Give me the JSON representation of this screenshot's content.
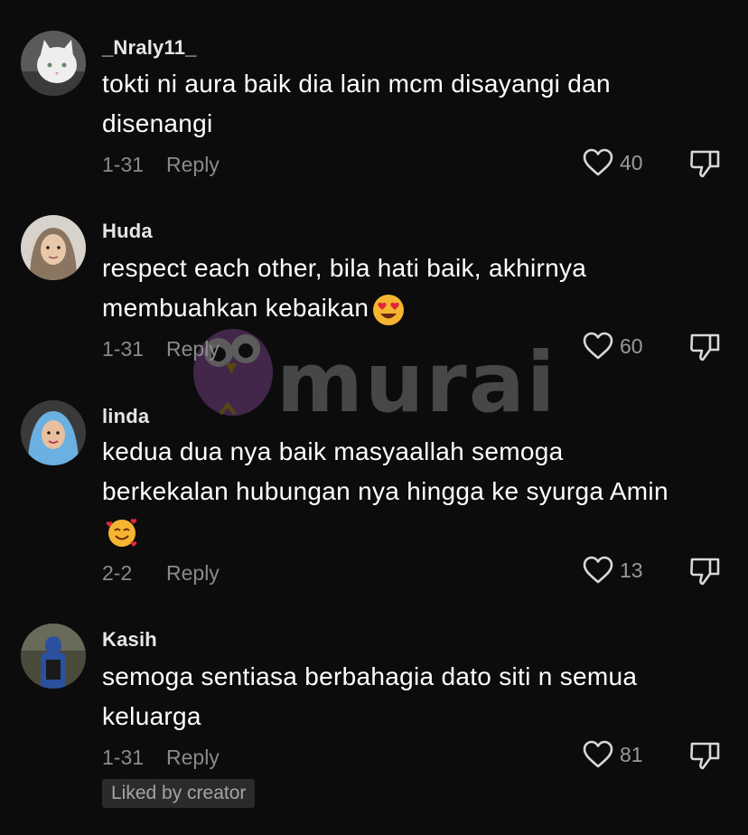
{
  "comments": [
    {
      "username": "_Nraly11_",
      "text": "tokti ni aura baik dia lain mcm disayangi dan disenangi",
      "date": "1-31",
      "reply_label": "Reply",
      "likes": "40",
      "avatar": "white-cat-avatar"
    },
    {
      "username": "Huda",
      "text": "respect each other, bila hati baik, akhirnya membuahkan kebaikan",
      "emoji": "heart-eyes-emoji",
      "date": "1-31",
      "reply_label": "Reply",
      "likes": "60",
      "avatar": "hijab-woman-avatar"
    },
    {
      "username": "linda",
      "text": "kedua dua nya baik masyaallah semoga berkekalan hubungan nya hingga ke syurga Amin",
      "emoji": "smiling-face-with-hearts-emoji",
      "date": "2-2",
      "reply_label": "Reply",
      "likes": "13",
      "avatar": "blue-hijab-avatar"
    },
    {
      "username": "Kasih",
      "text": "semoga sentiasa berbahagia dato siti n semua keluarga",
      "date": "1-31",
      "reply_label": "Reply",
      "likes": "81",
      "avatar": "person-in-blue-avatar",
      "badge": "Liked by creator"
    }
  ],
  "watermark": "murai",
  "colors": {
    "background": "#0c0c0c",
    "text": "#ffffff",
    "muted": "#8a8a8a",
    "badge_bg": "#2b2b2b",
    "watermark_owl": "#7a4a8a"
  }
}
